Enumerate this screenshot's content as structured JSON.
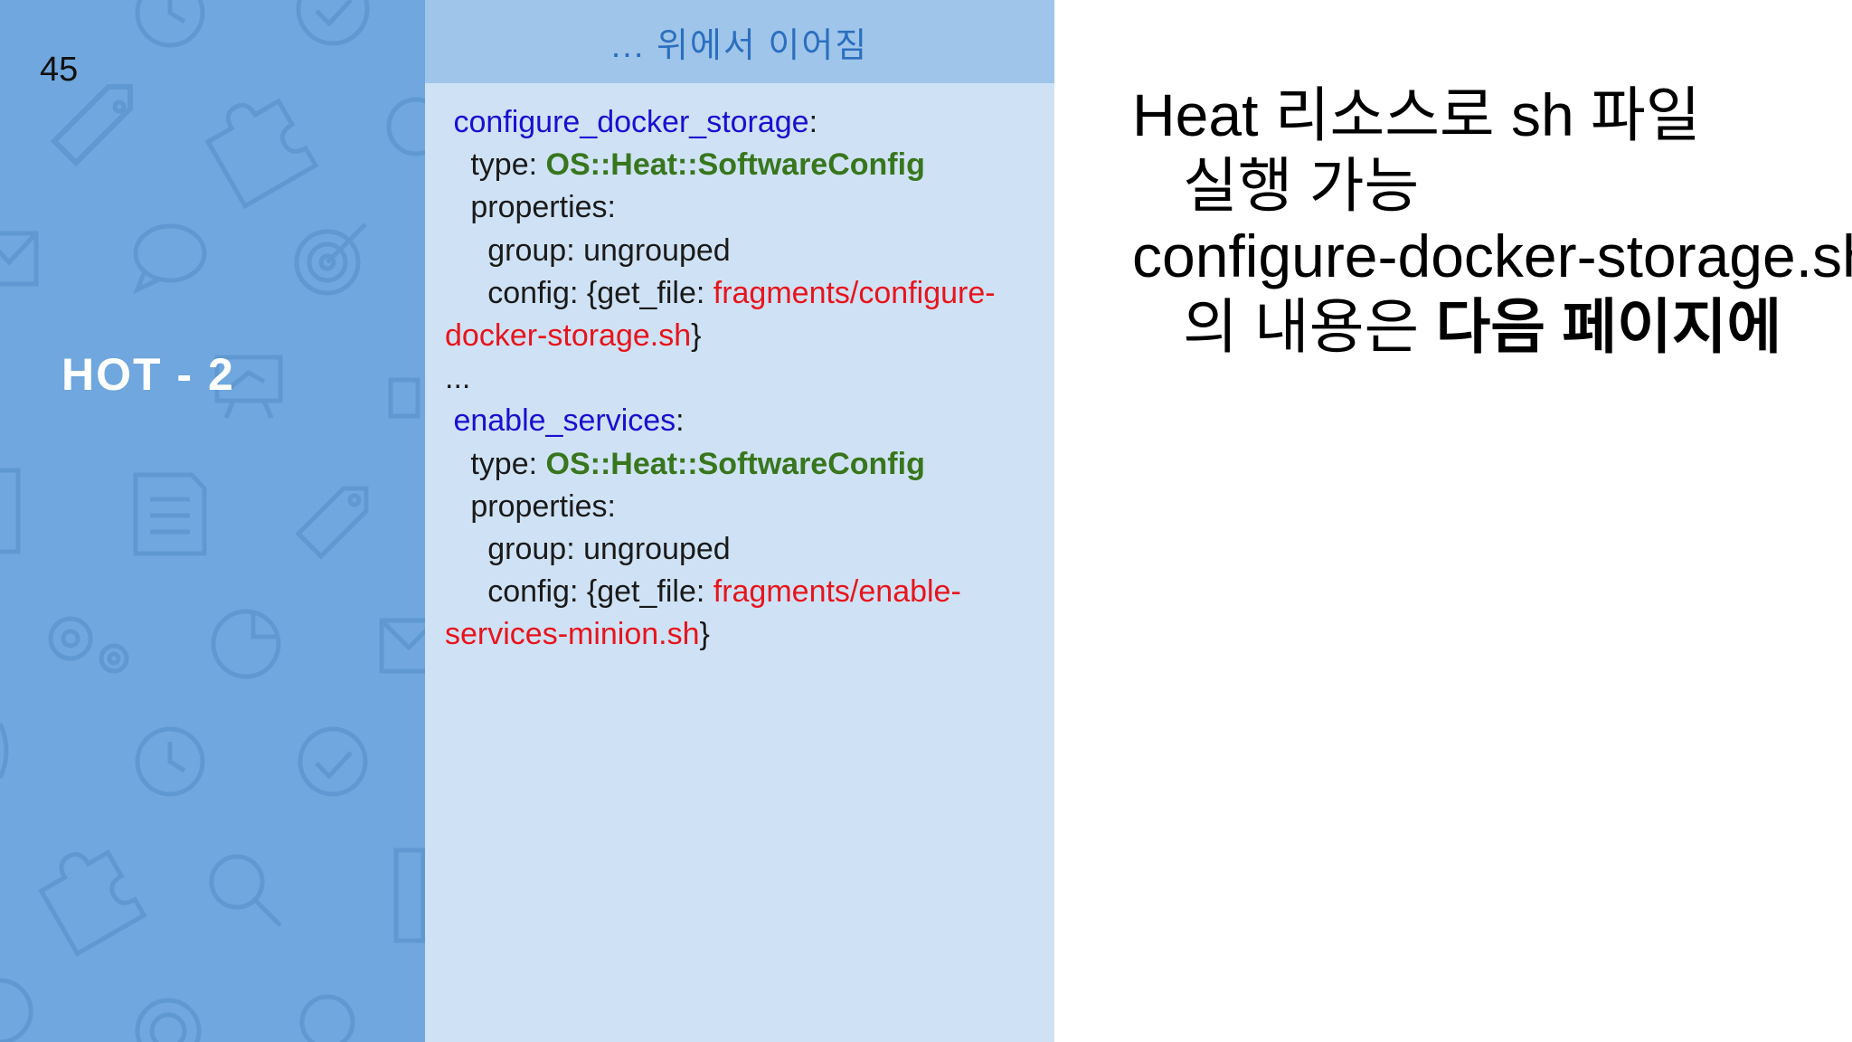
{
  "slide": {
    "number": "45",
    "section_title": "HOT - 2"
  },
  "code_panel": {
    "header": "... 위에서 이어짐",
    "blocks": [
      {
        "resource": "configure_docker_storage",
        "type_label": "type: ",
        "type_value": "OS::Heat::SoftwareConfig",
        "properties_label": "properties:",
        "group_line": "group: ungrouped",
        "config_prefix": "config: {get_file: ",
        "file_part1": "fragments/configure-",
        "file_part2": "docker-storage.sh",
        "config_suffix": "}"
      },
      {
        "resource": "enable_services",
        "type_label": "type: ",
        "type_value": "OS::Heat::SoftwareConfig",
        "properties_label": "properties:",
        "group_line": "group: ungrouped",
        "config_prefix": "config: {get_file: ",
        "file_part1": "fragments/enable-",
        "file_part2": "services-minion.sh",
        "config_suffix": "}"
      }
    ],
    "ellipsis": "...",
    "colon": ":"
  },
  "right": {
    "line1": "Heat 리소스로 sh 파일",
    "line2": "실행 가능",
    "line3": "configure-docker-storage.sh",
    "line4_regular": "의 내용은 ",
    "line4_bold": "다음 페이지에"
  },
  "colors": {
    "sidebar": "#6fa7de",
    "code_bg": "#cfe2f5",
    "code_header_bg": "#9fc5ea",
    "resource_blue": "#1a0fd1",
    "type_green": "#38761d",
    "file_red": "#e8141c"
  },
  "icons": [
    "clock-icon",
    "check-circle-icon",
    "tag-icon",
    "puzzle-icon",
    "target-icon",
    "envelope-icon",
    "chat-bubble-icon",
    "presentation-icon",
    "document-icon",
    "gears-icon",
    "pie-chart-icon",
    "magnifier-icon"
  ]
}
